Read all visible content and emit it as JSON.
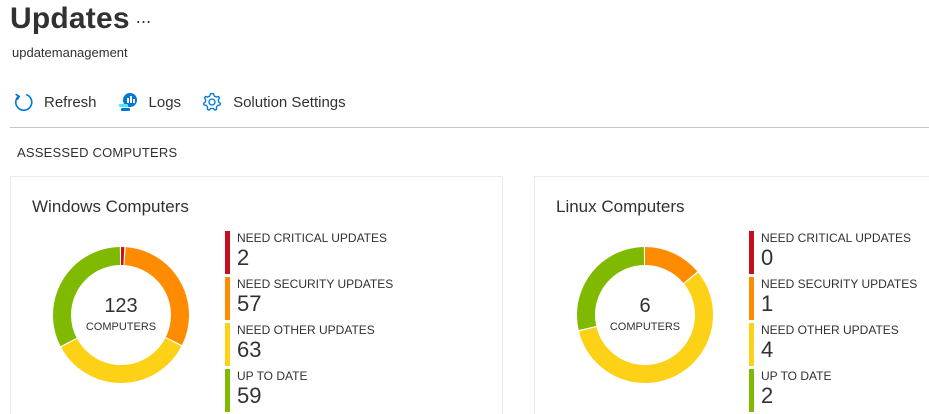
{
  "header": {
    "title": "Updates",
    "more": "...",
    "subtitle": "updatemanagement"
  },
  "toolbar": {
    "refresh": {
      "label": "Refresh",
      "icon": "refresh-icon"
    },
    "logs": {
      "label": "Logs",
      "icon": "logs-icon"
    },
    "settings": {
      "label": "Solution Settings",
      "icon": "gear-icon"
    }
  },
  "section": {
    "label": "ASSESSED COMPUTERS"
  },
  "colors": {
    "critical": "#c50f1f",
    "security": "#ff8c00",
    "other": "#fcd116",
    "uptodate": "#7fba00",
    "accent": "#0078d4"
  },
  "cards": [
    {
      "title": "Windows Computers",
      "count": "123",
      "count_label": "COMPUTERS",
      "items": [
        {
          "label": "NEED CRITICAL UPDATES",
          "value": "2"
        },
        {
          "label": "NEED SECURITY UPDATES",
          "value": "57"
        },
        {
          "label": "NEED OTHER UPDATES",
          "value": "63"
        },
        {
          "label": "UP TO DATE",
          "value": "59"
        }
      ]
    },
    {
      "title": "Linux Computers",
      "count": "6",
      "count_label": "COMPUTERS",
      "items": [
        {
          "label": "NEED CRITICAL UPDATES",
          "value": "0"
        },
        {
          "label": "NEED SECURITY UPDATES",
          "value": "1"
        },
        {
          "label": "NEED OTHER UPDATES",
          "value": "4"
        },
        {
          "label": "UP TO DATE",
          "value": "2"
        }
      ]
    }
  ]
}
